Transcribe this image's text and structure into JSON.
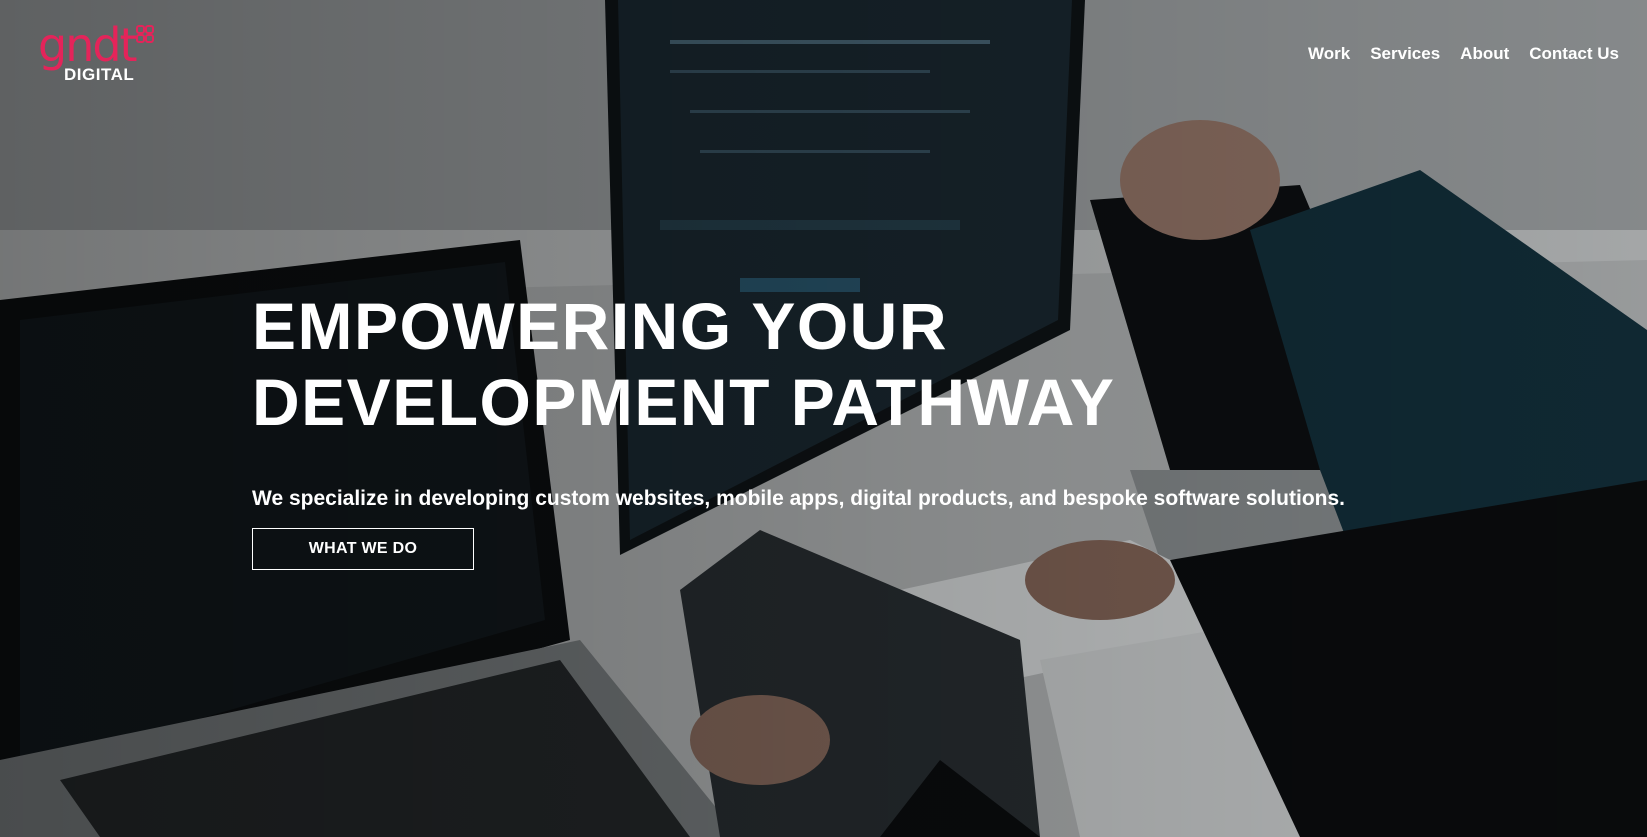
{
  "header": {
    "logo": {
      "mark": "gndt",
      "word": "DIGITAL",
      "accent": "#e4245a"
    },
    "nav": [
      "Work",
      "Services",
      "About",
      "Contact Us"
    ]
  },
  "hero": {
    "headline_line1": "EMPOWERING YOUR",
    "headline_line2": "DEVELOPMENT PATHWAY",
    "lead": "We specialize in developing custom websites, mobile apps, digital products, and bespoke software solutions.",
    "cta_label": "WHAT WE DO"
  },
  "colors": {
    "brand": "#e4245a",
    "text": "#ffffff"
  }
}
